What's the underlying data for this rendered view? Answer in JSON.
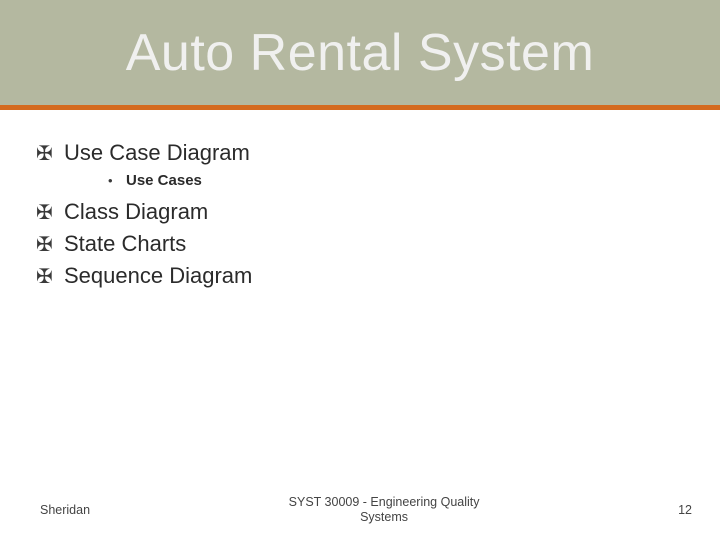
{
  "title": "Auto Rental System",
  "items": [
    {
      "label": "Use Case Diagram",
      "sub": [
        {
          "label": "Use Cases"
        }
      ]
    },
    {
      "label": "Class Diagram"
    },
    {
      "label": "State Charts"
    },
    {
      "label": "Sequence Diagram"
    }
  ],
  "footer": {
    "left": "Sheridan",
    "center_line1": "SYST 30009 - Engineering Quality",
    "center_line2": "Systems",
    "right": "12"
  }
}
